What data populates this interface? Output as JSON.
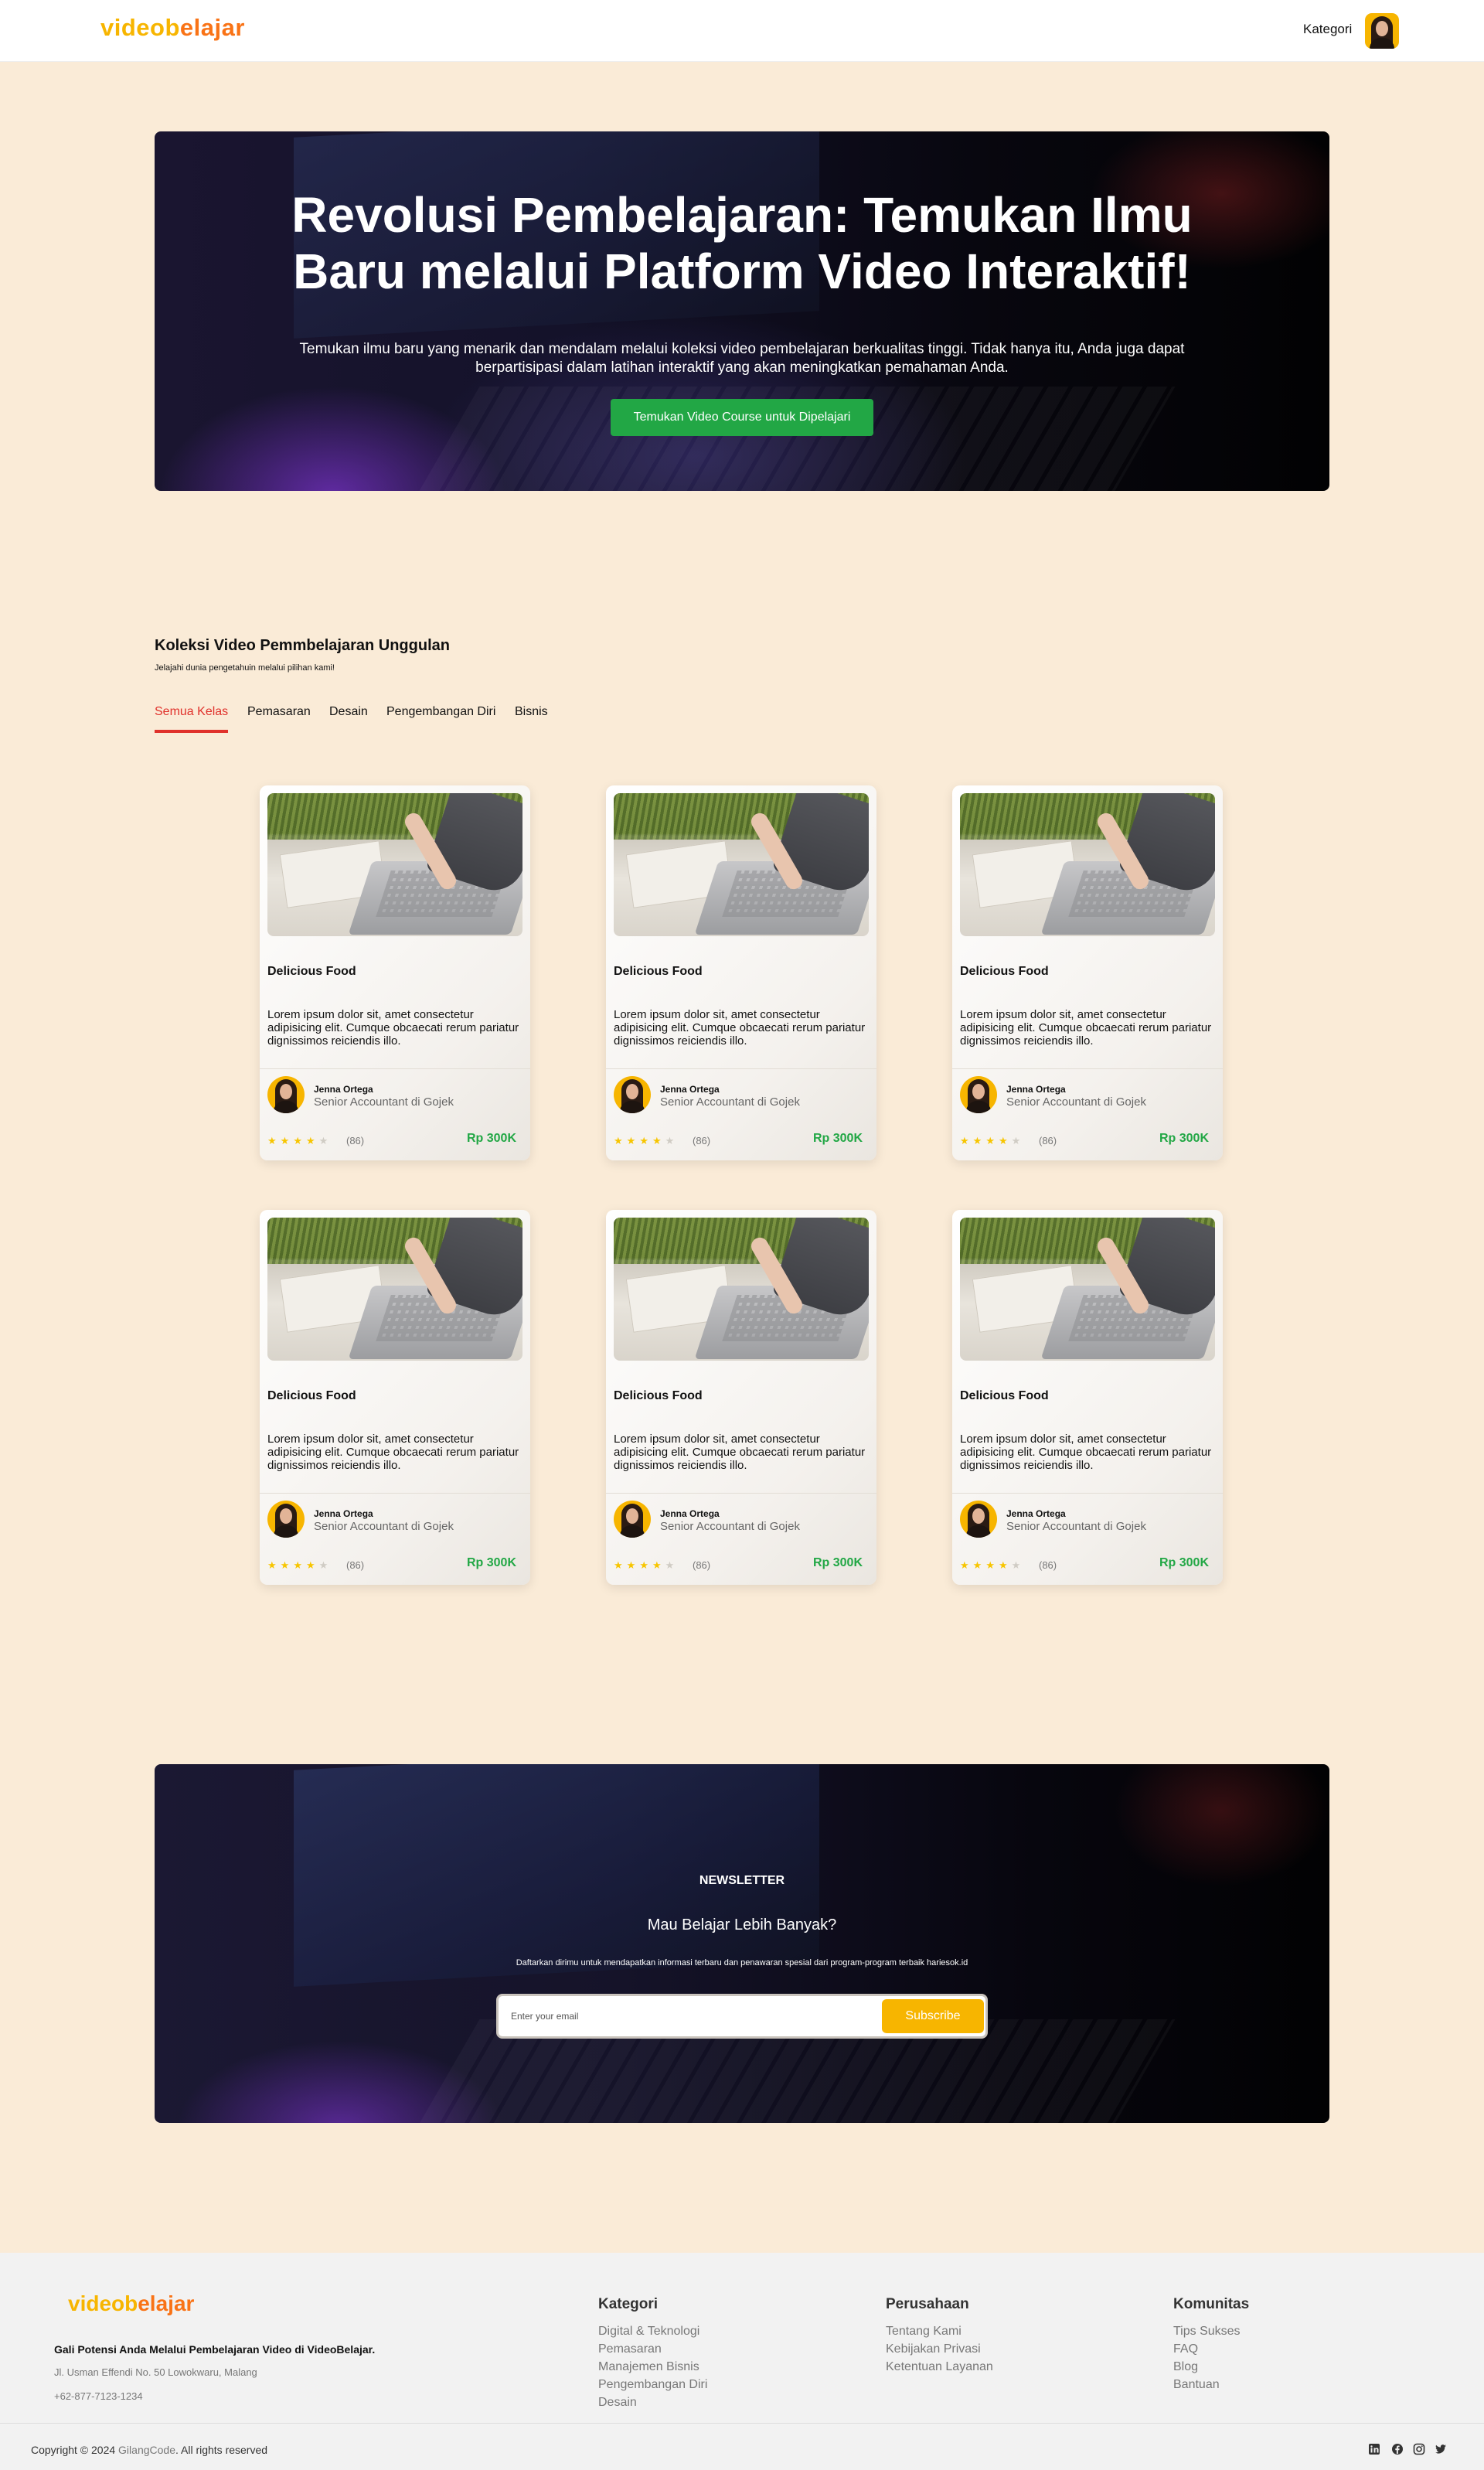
{
  "nav": {
    "logo_part1": "videob",
    "logo_part2": "elajar",
    "category_link": "Kategori"
  },
  "hero": {
    "title_line1": "Revolusi Pembelajaran: Temukan Ilmu",
    "title_line2": "Baru melalui Platform Video Interaktif!",
    "subtitle": "Temukan ilmu baru yang menarik dan mendalam melalui koleksi video pembelajaran berkualitas tinggi. Tidak hanya itu, Anda juga dapat berpartisipasi dalam latihan interaktif yang akan meningkatkan pemahaman Anda.",
    "cta_label": "Temukan Video Course untuk Dipelajari"
  },
  "collection": {
    "title": "Koleksi Video Pemmbelajaran Unggulan",
    "subtitle": "Jelajahi dunia pengetahuin melalui pilihan kami!",
    "tabs": [
      {
        "label": "Semua Kelas",
        "active": true
      },
      {
        "label": "Pemasaran",
        "active": false
      },
      {
        "label": "Desain",
        "active": false
      },
      {
        "label": "Pengembangan Diri",
        "active": false
      },
      {
        "label": "Bisnis",
        "active": false
      }
    ],
    "cards": [
      {
        "title": "Delicious Food",
        "description": "Lorem ipsum dolor sit, amet consectetur adipisicing elit. Cumque obcaecati rerum pariatur dignissimos reiciendis illo.",
        "author": "Jenna Ortega",
        "role": "Senior Accountant di Gojek",
        "rating": 4,
        "rating_max": 5,
        "reviews": "(86)",
        "price": "Rp 300K"
      },
      {
        "title": "Delicious Food",
        "description": "Lorem ipsum dolor sit, amet consectetur adipisicing elit. Cumque obcaecati rerum pariatur dignissimos reiciendis illo.",
        "author": "Jenna Ortega",
        "role": "Senior Accountant di Gojek",
        "rating": 4,
        "rating_max": 5,
        "reviews": "(86)",
        "price": "Rp 300K"
      },
      {
        "title": "Delicious Food",
        "description": "Lorem ipsum dolor sit, amet consectetur adipisicing elit. Cumque obcaecati rerum pariatur dignissimos reiciendis illo.",
        "author": "Jenna Ortega",
        "role": "Senior Accountant di Gojek",
        "rating": 4,
        "rating_max": 5,
        "reviews": "(86)",
        "price": "Rp 300K"
      },
      {
        "title": "Delicious Food",
        "description": "Lorem ipsum dolor sit, amet consectetur adipisicing elit. Cumque obcaecati rerum pariatur dignissimos reiciendis illo.",
        "author": "Jenna Ortega",
        "role": "Senior Accountant di Gojek",
        "rating": 4,
        "rating_max": 5,
        "reviews": "(86)",
        "price": "Rp 300K"
      },
      {
        "title": "Delicious Food",
        "description": "Lorem ipsum dolor sit, amet consectetur adipisicing elit. Cumque obcaecati rerum pariatur dignissimos reiciendis illo.",
        "author": "Jenna Ortega",
        "role": "Senior Accountant di Gojek",
        "rating": 4,
        "rating_max": 5,
        "reviews": "(86)",
        "price": "Rp 300K"
      },
      {
        "title": "Delicious Food",
        "description": "Lorem ipsum dolor sit, amet consectetur adipisicing elit. Cumque obcaecati rerum pariatur dignissimos reiciendis illo.",
        "author": "Jenna Ortega",
        "role": "Senior Accountant di Gojek",
        "rating": 4,
        "rating_max": 5,
        "reviews": "(86)",
        "price": "Rp 300K"
      }
    ]
  },
  "newsletter": {
    "label": "NEWSLETTER",
    "title": "Mau Belajar Lebih Banyak?",
    "description": "Daftarkan dirimu untuk mendapatkan informasi terbaru dan penawaran spesial dari program-program terbaik hariesok.id",
    "placeholder": "Enter your email",
    "button_label": "Subscribe"
  },
  "footer": {
    "logo_part1": "videob",
    "logo_part2": "elajar",
    "tagline": "Gali Potensi Anda Melalui Pembelajaran Video di VideoBelajar.",
    "address": "Jl. Usman Effendi No. 50 Lowokwaru, Malang",
    "phone": "+62-877-7123-1234",
    "columns": [
      {
        "title": "Kategori",
        "links": [
          "Digital & Teknologi",
          "Pemasaran",
          "Manajemen Bisnis",
          "Pengembangan Diri",
          "Desain"
        ]
      },
      {
        "title": "Perusahaan",
        "links": [
          "Tentang Kami",
          "Kebijakan Privasi",
          "Ketentuan Layanan"
        ]
      },
      {
        "title": "Komunitas",
        "links": [
          "Tips Sukses",
          "FAQ",
          "Blog",
          "Bantuan"
        ]
      }
    ],
    "copyright_prefix": "Copyright © 2024",
    "copyright_brand": "GilangCode",
    "copyright_suffix": ". All rights reserved",
    "social_icons": [
      "linkedin-icon",
      "facebook-icon",
      "instagram-icon",
      "twitter-icon"
    ]
  },
  "colors": {
    "page_bg": "#FAEBD7",
    "accent_yellow": "#F7B500",
    "accent_orange": "#F97316",
    "green": "#22A745",
    "tab_active": "#E0312B"
  }
}
